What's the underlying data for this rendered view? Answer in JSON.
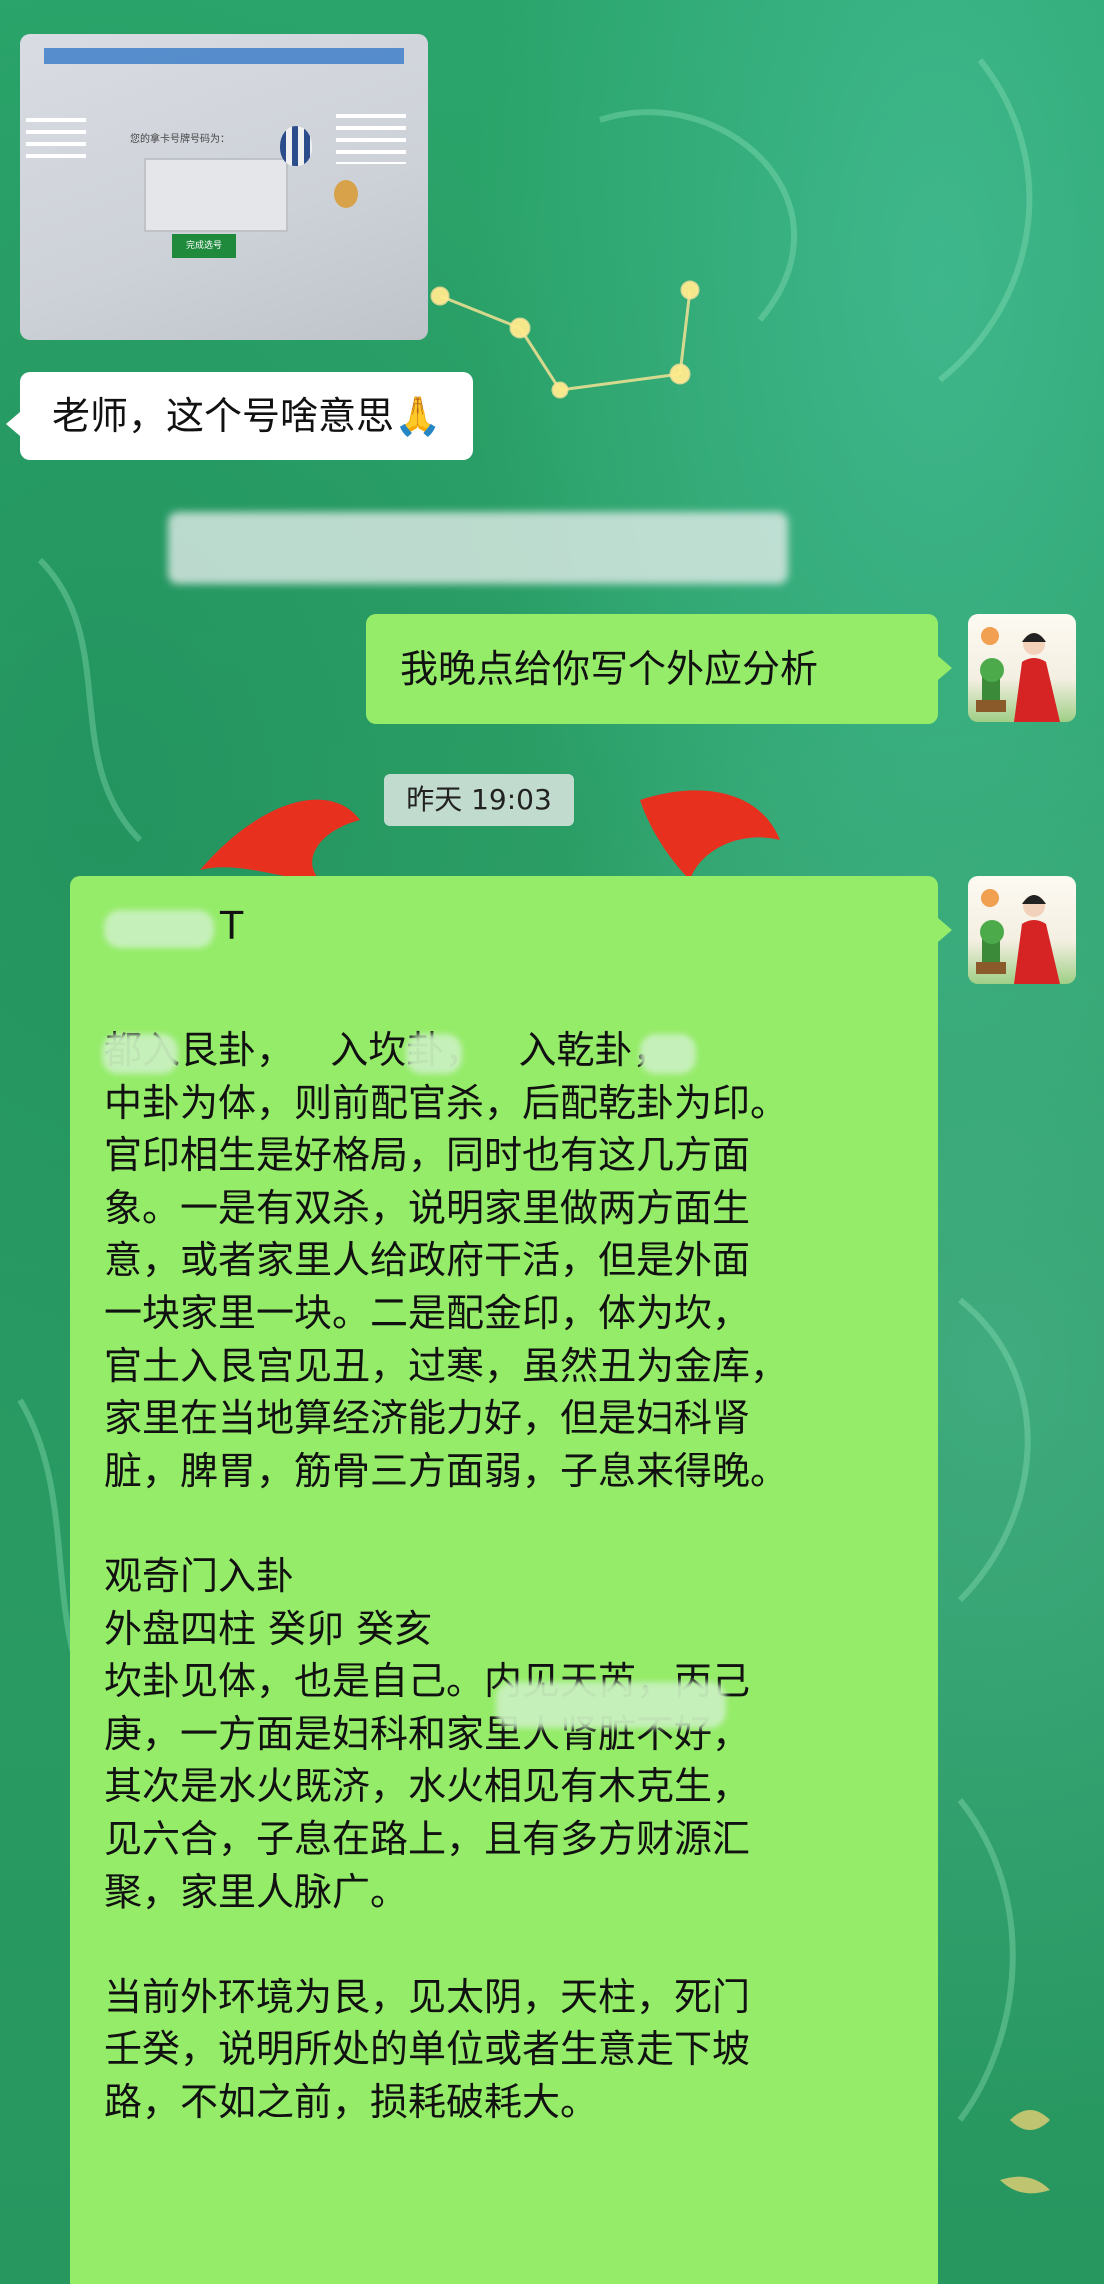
{
  "messages": {
    "incoming_question": "老师，这个号啥意思🙏",
    "outgoing_reply": "我晚点给你写个外应分析",
    "timestamp": "昨天 19:03",
    "analysis_header": "T",
    "analysis_lines": [
      "都入艮卦，   入坎卦，   入乾卦，",
      "中卦为体，则前配官杀，后配乾卦为印。",
      "官印相生是好格局，同时也有这几方面",
      "象。一是有双杀，说明家里做两方面生",
      "意，或者家里人给政府干活，但是外面",
      "一块家里一块。二是配金印，体为坎，",
      "官土入艮宫见丑，过寒，虽然丑为金库，",
      "家里在当地算经济能力好，但是妇科肾",
      "脏，脾胃，筋骨三方面弱，子息来得晚。",
      "",
      "观奇门入卦",
      "外盘四柱 癸卯 癸亥",
      "坎卦见体，也是自己。内见天芮，丙己",
      "庚，一方面是妇科和家里人肾脏不好，",
      "其次是水火既济，水火相见有木克生，",
      "见六合，子息在路上，且有多方财源汇",
      "聚，家里人脉广。",
      "",
      "当前外环境为艮，见太阴，天柱，死门",
      "壬癸，说明所处的单位或者生意走下坡",
      "路，不如之前，损耗破耗大。"
    ]
  },
  "screenshot_thumb": {
    "button_label": "完成选号",
    "prompt_label": "您的拿卡号牌号码为："
  },
  "colors": {
    "chat_bg": "#2fa264",
    "bubble_out": "#95ec69",
    "bubble_in": "#ffffff"
  }
}
